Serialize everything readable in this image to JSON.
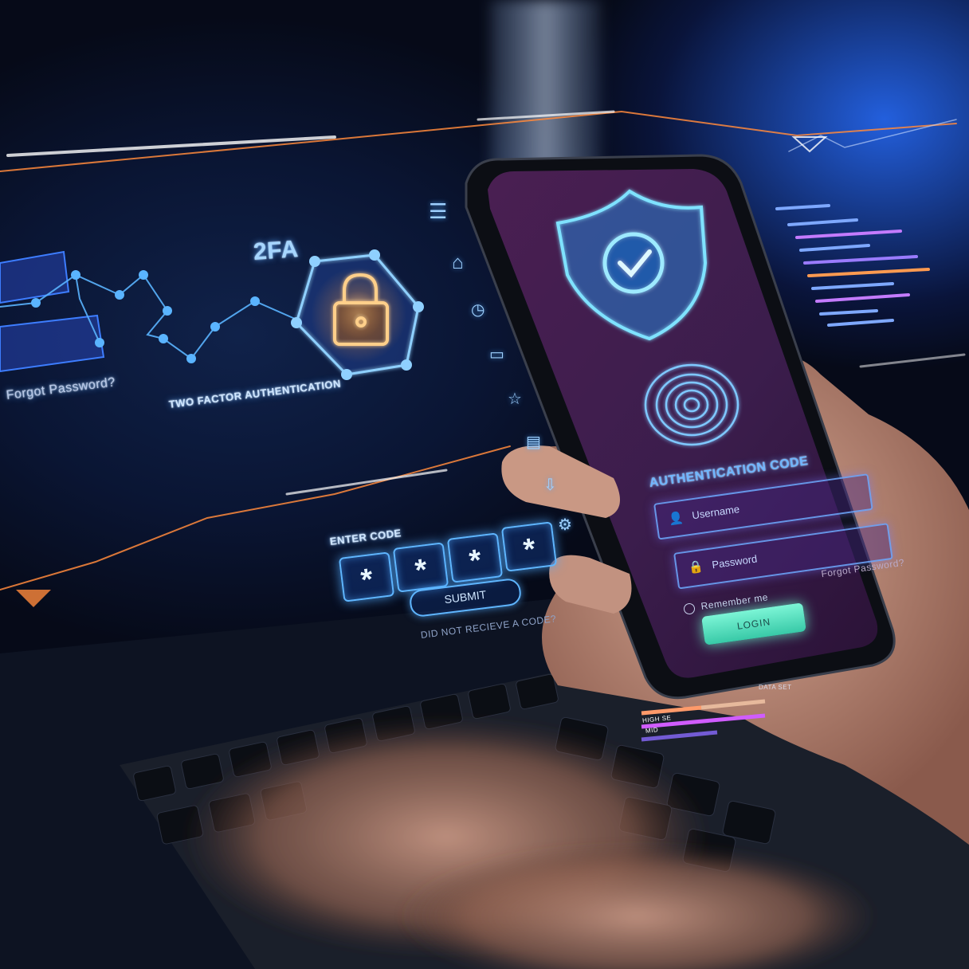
{
  "scene": {
    "panel_left_label": "Forgot Password?",
    "twofa_title": "2FA",
    "twofa_caption": "TWO FACTOR AUTHENTICATION",
    "enter_code_label": "ENTER CODE",
    "code_digits": [
      "*",
      "*",
      "*",
      "*"
    ],
    "submit_label": "SUBMIT",
    "no_code_label": "DID NOT RECIEVE A CODE?"
  },
  "phone": {
    "auth_title": "AUTHENTICATION CODE",
    "username_label": "Username",
    "password_label": "Password",
    "remember_label": "Remember me",
    "login_label": "LOGIN",
    "forgot_label": "Forgot Password?"
  },
  "sidebar_icons": [
    "menu-icon",
    "home-icon",
    "clock-icon",
    "folder-icon",
    "star-icon",
    "document-icon",
    "download-icon",
    "gear-icon"
  ],
  "hud": {
    "data_set_label": "DATA SET",
    "high_label": "HIGH SE",
    "mid_label": "MID"
  },
  "colors": {
    "accent_blue": "#5fb6ff",
    "accent_orange": "#ff8a3c",
    "login_green": "#5fe8c4",
    "phone_screen": "#3a1d4a"
  }
}
